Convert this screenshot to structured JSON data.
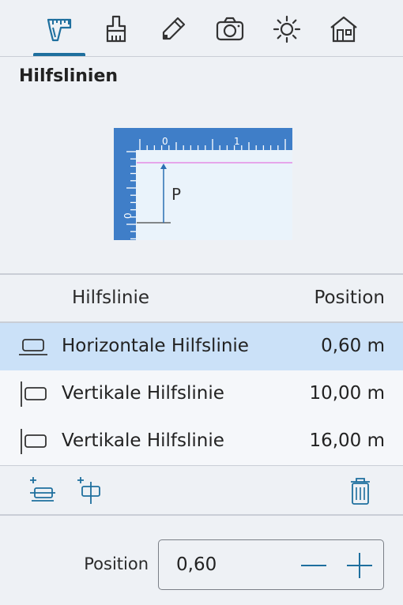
{
  "toolbar": {
    "tools": [
      {
        "icon": "ruler-caliper-icon",
        "selected": true
      },
      {
        "icon": "brush-icon"
      },
      {
        "icon": "pencil-icon"
      },
      {
        "icon": "camera-icon"
      },
      {
        "icon": "sun-icon"
      },
      {
        "icon": "house-icon"
      }
    ],
    "accent": "#1e6f9e"
  },
  "section": {
    "title": "Hilfslinien"
  },
  "diagram": {
    "ruler_top_ticks": [
      "0",
      "1"
    ],
    "ruler_left_tick": "0",
    "point_label": "P",
    "ruler_color": "#3f7ec8",
    "guide_color": "#e48be4"
  },
  "list": {
    "columns": {
      "name": "Hilfslinie",
      "position": "Position"
    },
    "rows": [
      {
        "name": "Horizontale Hilfslinie",
        "position": "0,60 m",
        "icon": "horizontal-guide-icon",
        "selected": true
      },
      {
        "name": "Vertikale Hilfslinie",
        "position": "10,00 m",
        "icon": "vertical-guide-icon",
        "selected": false
      },
      {
        "name": "Vertikale Hilfslinie",
        "position": "16,00 m",
        "icon": "vertical-guide-icon",
        "selected": false
      }
    ]
  },
  "actions": {
    "add_horizontal": "add-horizontal-guide-icon",
    "add_vertical": "add-vertical-guide-icon",
    "delete": "trash-icon"
  },
  "position_field": {
    "label": "Position",
    "value": "0,60",
    "decrement": "minus-icon",
    "increment": "plus-icon"
  }
}
